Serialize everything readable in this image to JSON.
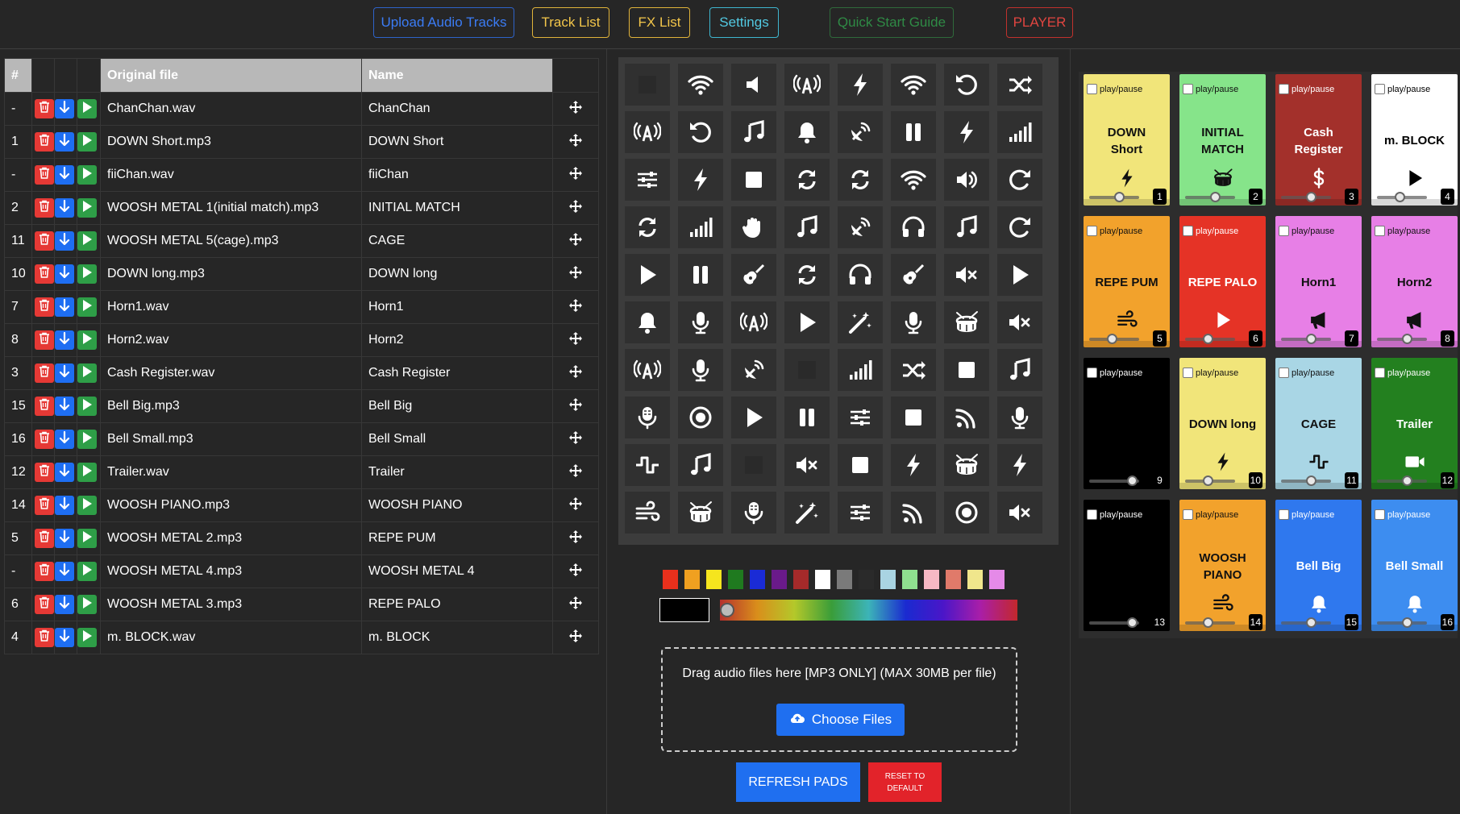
{
  "nav": {
    "upload": "Upload Audio Tracks",
    "tracklist": "Track List",
    "fxlist": "FX List",
    "settings": "Settings",
    "quickstart": "Quick Start Guide",
    "player": "PLAYER"
  },
  "tracks": {
    "headers": {
      "num": "#",
      "original": "Original file",
      "name": "Name"
    },
    "rows": [
      {
        "num": "-",
        "original": "ChanChan.wav",
        "name": "ChanChan"
      },
      {
        "num": "1",
        "original": "DOWN Short.mp3",
        "name": "DOWN Short"
      },
      {
        "num": "-",
        "original": "fiiChan.wav",
        "name": "fiiChan"
      },
      {
        "num": "2",
        "original": "WOOSH METAL 1(initial match).mp3",
        "name": "INITIAL MATCH"
      },
      {
        "num": "11",
        "original": "WOOSH METAL 5(cage).mp3",
        "name": "CAGE"
      },
      {
        "num": "10",
        "original": "DOWN long.mp3",
        "name": "DOWN long"
      },
      {
        "num": "7",
        "original": "Horn1.wav",
        "name": "Horn1"
      },
      {
        "num": "8",
        "original": "Horn2.wav",
        "name": "Horn2"
      },
      {
        "num": "3",
        "original": "Cash Register.wav",
        "name": "Cash Register"
      },
      {
        "num": "15",
        "original": "Bell Big.mp3",
        "name": "Bell Big"
      },
      {
        "num": "16",
        "original": "Bell Small.mp3",
        "name": "Bell Small"
      },
      {
        "num": "12",
        "original": "Trailer.wav",
        "name": "Trailer"
      },
      {
        "num": "14",
        "original": "WOOSH PIANO.mp3",
        "name": "WOOSH PIANO"
      },
      {
        "num": "5",
        "original": "WOOSH METAL 2.mp3",
        "name": "REPE PUM"
      },
      {
        "num": "-",
        "original": "WOOSH METAL 4.mp3",
        "name": "WOOSH METAL 4"
      },
      {
        "num": "6",
        "original": "WOOSH METAL 3.mp3",
        "name": "REPE PALO"
      },
      {
        "num": "4",
        "original": "m. BLOCK.wav",
        "name": "m. BLOCK"
      }
    ]
  },
  "icon_grid": [
    [
      "blank",
      "wifi",
      "speaker",
      "broadcast",
      "bolt",
      "wifi",
      "undo",
      "shuffle"
    ],
    [
      "broadcast",
      "undo",
      "music",
      "bell",
      "satellite",
      "pause",
      "bolt",
      "signal"
    ],
    [
      "sliders",
      "bolt",
      "stop",
      "sync",
      "sync",
      "wifi",
      "volume",
      "redo"
    ],
    [
      "sync",
      "signal",
      "hand",
      "music",
      "satellite",
      "headphones",
      "music",
      "redo"
    ],
    [
      "play",
      "pause",
      "guitar",
      "sync",
      "headphones",
      "guitar",
      "mute",
      "play"
    ],
    [
      "bell",
      "mic",
      "broadcast",
      "play",
      "wand",
      "mic",
      "drum",
      "mute"
    ],
    [
      "broadcast",
      "mic",
      "satellite",
      "blank",
      "signal",
      "shuffle",
      "stop",
      "music"
    ],
    [
      "mic-lines",
      "record",
      "play",
      "pause",
      "sliders",
      "stop",
      "rss",
      "mic"
    ],
    [
      "wave",
      "music",
      "blank",
      "mute",
      "stop",
      "bolt",
      "drum",
      "bolt"
    ],
    [
      "wind",
      "drum",
      "mic-lines",
      "wand",
      "sliders",
      "rss",
      "record",
      "mute"
    ]
  ],
  "colors": {
    "swatches": [
      "#e8301c",
      "#f0a020",
      "#f5e51e",
      "#1f7a1f",
      "#1a2bd6",
      "#6a1a8a",
      "#a52a2a",
      "#ffffff",
      "#7a7a7a",
      "#2a2a2a",
      "#a9d4e2",
      "#8fe08f",
      "#f7b8c4",
      "#e07a6a",
      "#f0e68c",
      "#e58ae8"
    ],
    "selected": "#000000"
  },
  "upload": {
    "drop_text": "Drag audio files here [MP3 ONLY] (MAX 30MB per file)",
    "choose": "Choose Files"
  },
  "buttons": {
    "refresh": "REFRESH PADS",
    "reset_line1": "RESET TO",
    "reset_line2": "DEFAULT"
  },
  "pads": [
    {
      "label": "play/pause",
      "name": "DOWN\nShort",
      "icon": "bolt",
      "num": "1",
      "bg": "#f1e57a",
      "fg": "#111111",
      "level": 0.6
    },
    {
      "label": "play/pause",
      "name": "INITIAL\nMATCH",
      "icon": "drum",
      "num": "2",
      "bg": "#86e48a",
      "fg": "#111111",
      "level": 0.6
    },
    {
      "label": "play/pause",
      "name": "Cash\nRegister",
      "icon": "dollar",
      "num": "3",
      "bg": "#a3302b",
      "fg": "#ffffff",
      "level": 0.6
    },
    {
      "label": "play/pause",
      "name": "m. BLOCK",
      "icon": "play",
      "num": "4",
      "bg": "#ffffff",
      "fg": "#000000",
      "level": 0.45
    },
    {
      "label": "play/pause",
      "name": "REPE PUM",
      "icon": "wind",
      "num": "5",
      "bg": "#f2a22c",
      "fg": "#111111",
      "level": 0.45
    },
    {
      "label": "play/pause",
      "name": "REPE PALO",
      "icon": "play",
      "num": "6",
      "bg": "#e53326",
      "fg": "#ffffff",
      "level": 0.45
    },
    {
      "label": "play/pause",
      "name": "Horn1",
      "icon": "bullhorn",
      "num": "7",
      "bg": "#e77fe6",
      "fg": "#111111",
      "level": 0.6
    },
    {
      "label": "play/pause",
      "name": "Horn2",
      "icon": "bullhorn",
      "num": "8",
      "bg": "#e77fe6",
      "fg": "#111111",
      "level": 0.6
    },
    {
      "label": "play/pause",
      "name": "",
      "icon": "",
      "num": "9",
      "bg": "#000000",
      "fg": "#ffffff",
      "level": 0.85
    },
    {
      "label": "play/pause",
      "name": "DOWN long",
      "icon": "bolt",
      "num": "10",
      "bg": "#f1e57a",
      "fg": "#111111",
      "level": 0.45
    },
    {
      "label": "play/pause",
      "name": "CAGE",
      "icon": "wave",
      "num": "11",
      "bg": "#a9d6e5",
      "fg": "#111111",
      "level": 0.6
    },
    {
      "label": "play/pause",
      "name": "Trailer",
      "icon": "video",
      "num": "12",
      "bg": "#23801f",
      "fg": "#ffffff",
      "level": 0.6
    },
    {
      "label": "play/pause",
      "name": "",
      "icon": "",
      "num": "13",
      "bg": "#000000",
      "fg": "#ffffff",
      "level": 0.85
    },
    {
      "label": "play/pause",
      "name": "WOOSH\nPIANO",
      "icon": "wind",
      "num": "14",
      "bg": "#f2a22c",
      "fg": "#111111",
      "level": 0.45
    },
    {
      "label": "play/pause",
      "name": "Bell Big",
      "icon": "bell",
      "num": "15",
      "bg": "#2f78ee",
      "fg": "#ffffff",
      "level": 0.6
    },
    {
      "label": "play/pause",
      "name": "Bell Small",
      "icon": "bell",
      "num": "16",
      "bg": "#3d8df0",
      "fg": "#ffffff",
      "level": 0.6
    }
  ]
}
